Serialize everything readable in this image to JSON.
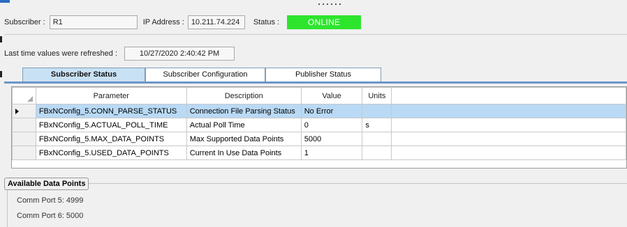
{
  "subscriber": {
    "label": "Subscriber :",
    "value": "R1"
  },
  "ip": {
    "label": "IP Address :",
    "value": "10.211.74.224"
  },
  "status": {
    "label": "Status :",
    "value": "ONLINE",
    "color": "#2ee52e"
  },
  "refresh": {
    "label": "Last time values were refreshed :",
    "value": "10/27/2020 2:40:42 PM"
  },
  "tabs": [
    {
      "label": "Subscriber Status",
      "active": true
    },
    {
      "label": "Subscriber Configuration",
      "active": false
    },
    {
      "label": "Publisher Status",
      "active": false
    }
  ],
  "grid": {
    "columns": [
      "Parameter",
      "Description",
      "Value",
      "Units"
    ],
    "rows": [
      {
        "parameter": "FBxNConfig_5.CONN_PARSE_STATUS",
        "description": "Connection File Parsing Status",
        "value": "No Error",
        "units": "",
        "selected": true
      },
      {
        "parameter": "FBxNConfig_5.ACTUAL_POLL_TIME",
        "description": "Actual Poll Time",
        "value": "0",
        "units": "s",
        "selected": false
      },
      {
        "parameter": "FBxNConfig_5.MAX_DATA_POINTS",
        "description": "Max Supported Data Points",
        "value": "5000",
        "units": "",
        "selected": false
      },
      {
        "parameter": "FBxNConfig_5.USED_DATA_POINTS",
        "description": "Current In Use Data Points",
        "value": "1",
        "units": "",
        "selected": false
      }
    ]
  },
  "available": {
    "title": "Available Data Points",
    "items": [
      "Comm Port 5:  4999",
      "Comm Port 6:  5000"
    ]
  },
  "accent_color": "#6b97c9"
}
